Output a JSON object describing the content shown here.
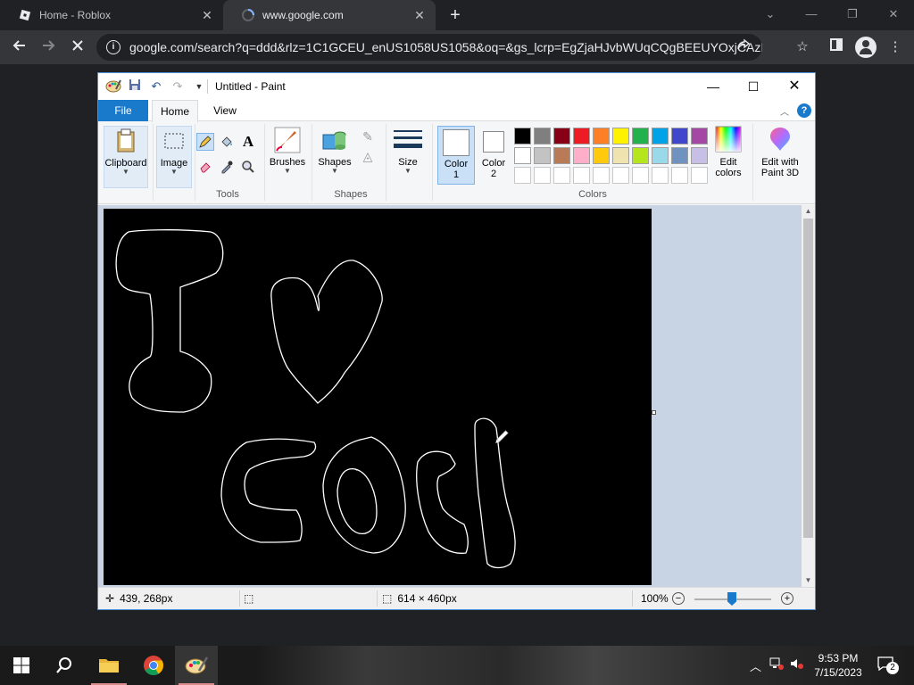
{
  "browser": {
    "tabs": [
      {
        "title": "Home - Roblox",
        "active": false
      },
      {
        "title": "www.google.com",
        "active": true
      }
    ],
    "url": "google.com/search?q=ddd&rlz=1C1GCEU_enUS1058US1058&oq=&gs_lcrp=EgZjaHJvbWUqCQgBEEUYOxjCAzIJ...",
    "new_tab": "+",
    "win_minimize": "⌄",
    "win_min": "—",
    "win_restore": "❐",
    "win_close": "✕"
  },
  "paint": {
    "title": "Untitled - Paint",
    "ribbon_tabs": {
      "file": "File",
      "home": "Home",
      "view": "View"
    },
    "groups": {
      "clipboard": "Clipboard",
      "image": "Image",
      "tools": "Tools",
      "brushes": "Brushes",
      "shapes_btn": "Shapes",
      "shapes": "Shapes",
      "size": "Size",
      "color1": "Color\n1",
      "color1_a": "Color",
      "color1_b": "1",
      "color2_a": "Color",
      "color2_b": "2",
      "colors": "Colors",
      "edit_colors_a": "Edit",
      "edit_colors_b": "colors",
      "paint3d_a": "Edit with",
      "paint3d_b": "Paint 3D"
    },
    "palette": {
      "row1": [
        "#000000",
        "#7f7f7f",
        "#880015",
        "#ed1c24",
        "#ff7f27",
        "#fff200",
        "#22b14c",
        "#00a2e8",
        "#3f48cc",
        "#a349a4"
      ],
      "row2": [
        "#ffffff",
        "#c3c3c3",
        "#b97a57",
        "#ffaec9",
        "#ffc90e",
        "#efe4b0",
        "#b5e61d",
        "#99d9ea",
        "#7092be",
        "#c8bfe7"
      ],
      "row3": [
        "#ffffff",
        "#ffffff",
        "#ffffff",
        "#ffffff",
        "#ffffff",
        "#ffffff",
        "#ffffff",
        "#ffffff",
        "#ffffff",
        "#ffffff"
      ]
    },
    "color1_value": "#ffffff",
    "color2_value": "#ffffff",
    "status": {
      "cursor_pos": "439, 268px",
      "canvas_size": "614 × 460px",
      "zoom": "100%"
    },
    "drawing_color": "#ffffff",
    "canvas_color": "#000000"
  },
  "taskbar": {
    "time": "9:53 PM",
    "date": "7/15/2023",
    "notifications": "2",
    "apps": [
      "start-icon",
      "search-icon",
      "file-explorer-icon",
      "chrome-icon",
      "paint-icon"
    ]
  }
}
